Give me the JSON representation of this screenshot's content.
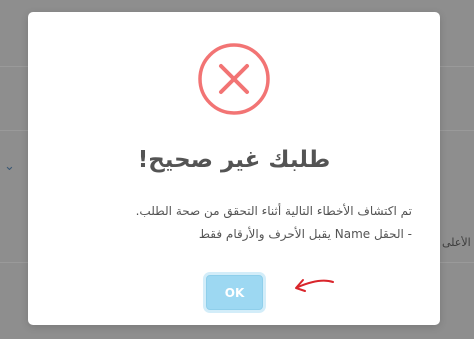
{
  "background": {
    "side_text": "الأعلى",
    "chevron_icon": "chevron-down-icon"
  },
  "modal": {
    "icon": "error-x-circle-icon",
    "icon_color": "#f27474",
    "title": "طلبك غير صحيح!",
    "message_lines": [
      "تم اكتشاف الأخطاء التالية أثناء التحقق من صحة الطلب.",
      "- الحقل Name يقبل الأحرف والأرقام فقط"
    ],
    "ok_label": "OK",
    "ok_color": "#9dd8f2"
  },
  "annotation": {
    "icon": "red-arrow-pointer-icon",
    "color": "#d9252b"
  }
}
